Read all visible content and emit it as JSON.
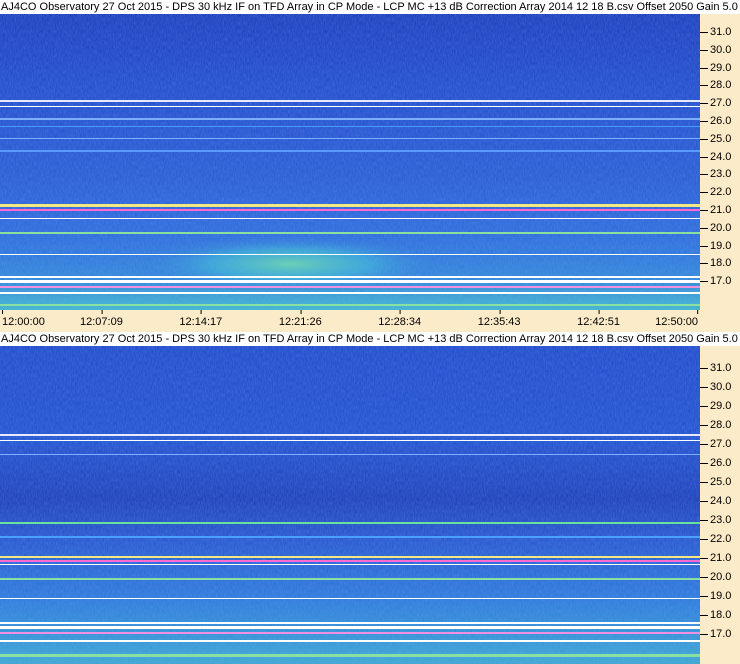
{
  "panels": [
    {
      "id": "top",
      "title": "AJ4CO Observatory 27 Oct 2015 - DPS 30 kHz IF on TFD Array in CP Mode - LCP  MC +13 dB  Correction Array 2014 12 18 B.csv  Offset 2050  Gain 5.0",
      "freq_labels": [
        "31.0",
        "30.0",
        "29.0",
        "28.0",
        "27.0",
        "26.0",
        "25.0",
        "24.0",
        "23.0",
        "22.0",
        "21.0",
        "20.0",
        "19.0",
        "18.0",
        "17.0"
      ],
      "time_labels": [
        "12:00:00",
        "12:07:09",
        "12:14:17",
        "12:21:26",
        "12:28:34",
        "12:35:43",
        "12:42:51",
        "12:50:00"
      ]
    },
    {
      "id": "bottom",
      "title": "AJ4CO Observatory 27 Oct 2015 - DPS 30 kHz IF on TFD Array in CP Mode - LCP  MC +13 dB  Correction Array 2014 12 18 B.csv  Offset 2050  Gain 5.0",
      "freq_labels": [
        "31.0",
        "30.0",
        "29.0",
        "28.0",
        "27.0",
        "26.0",
        "25.0",
        "24.0",
        "23.0",
        "22.0",
        "21.0",
        "20.0",
        "19.0",
        "18.0",
        "17.0"
      ],
      "time_labels": []
    }
  ],
  "colors": {
    "background_deep": "#1a3fc4",
    "background_mid": "#2c64dc",
    "emission_cyan": "#36c8d8",
    "emission_green": "#7ee07a",
    "line_white": "#ffffff",
    "line_yellow": "#f4e070",
    "axis_bg": "#fcebc8"
  }
}
